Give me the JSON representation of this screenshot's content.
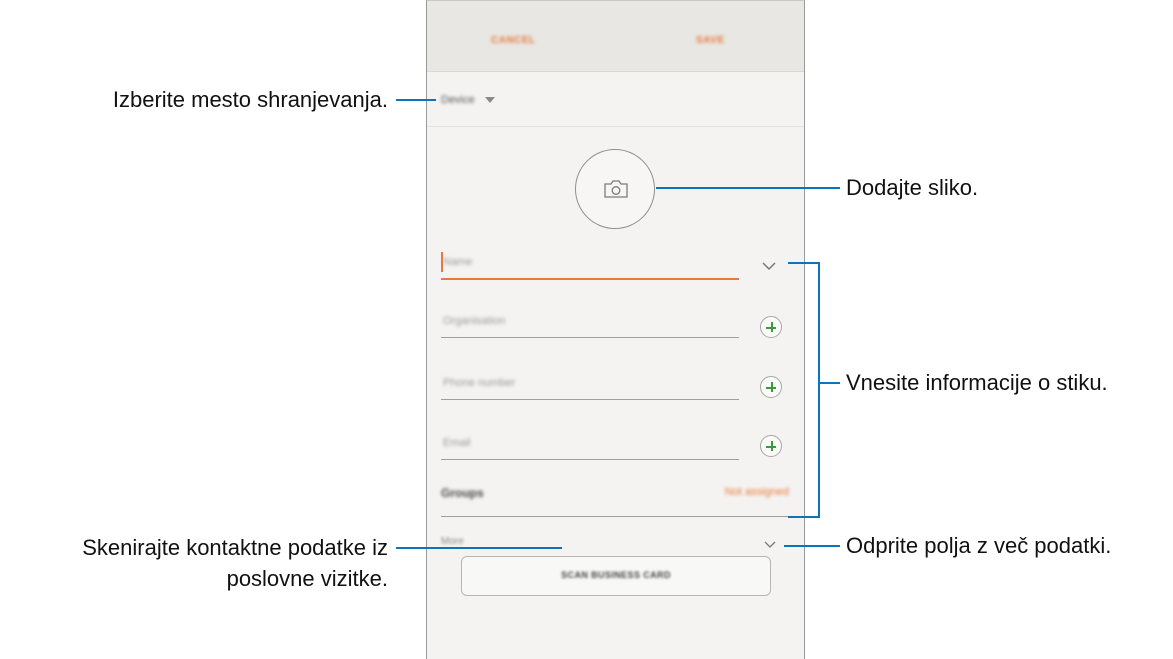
{
  "annotations": {
    "storage": "Izberite mesto shranjevanja.",
    "photo": "Dodajte sliko.",
    "info": "Vnesite informacije o stiku.",
    "more": "Odprite polja z več podatki.",
    "scan_line1": "Skenirajte kontaktne podatke iz",
    "scan_line2": "poslovne vizitke."
  },
  "screen": {
    "cancel_label": "CANCEL",
    "save_label": "SAVE",
    "storage_value": "Device",
    "name_placeholder": "Name",
    "organisation_placeholder": "Organisation",
    "phone_placeholder": "Phone number",
    "email_placeholder": "Email",
    "groups_label": "Groups",
    "groups_value": "Not assigned",
    "more_label": "More",
    "scan_button_label": "SCAN BUSINESS CARD"
  },
  "icons": {
    "camera": "camera-icon",
    "chevron": "chevron-down-icon",
    "add": "plus-icon",
    "storage_caret": "caret-down-icon"
  },
  "colors": {
    "accent": "#e8793a",
    "callout": "#0d74b9",
    "add_icon": "#3a9a3a"
  }
}
